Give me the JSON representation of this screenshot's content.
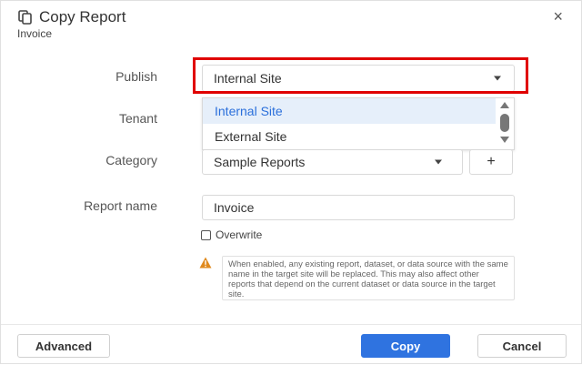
{
  "dialog": {
    "title": "Copy Report",
    "subtitle": "Invoice",
    "close_symbol": "×"
  },
  "form": {
    "publish": {
      "label": "Publish",
      "value": "Internal Site",
      "options": [
        "Internal Site",
        "External Site"
      ],
      "selected_option": "Internal Site"
    },
    "tenant": {
      "label": "Tenant"
    },
    "category": {
      "label": "Category",
      "value": "Sample Reports",
      "add_symbol": "+"
    },
    "report_name": {
      "label": "Report name",
      "value": "Invoice"
    },
    "overwrite": {
      "label": "Overwrite",
      "checked": false
    },
    "warning": {
      "text": "When enabled, any existing report, dataset, or data source with the same name in the target site will be replaced. This may also affect other reports that depend on the current dataset or data source in the target site."
    }
  },
  "footer": {
    "advanced_label": "Advanced",
    "copy_label": "Copy",
    "cancel_label": "Cancel"
  },
  "colors": {
    "primary": "#2f73e0",
    "highlight": "#e00000",
    "selected_bg": "#e6effa",
    "selected_text": "#2a6fdb",
    "warning": "#e08a1e"
  },
  "icons": {
    "title_icon": "copy-icon",
    "close": "close-icon",
    "warning": "warning-icon",
    "caret": "chevron-down-icon"
  }
}
